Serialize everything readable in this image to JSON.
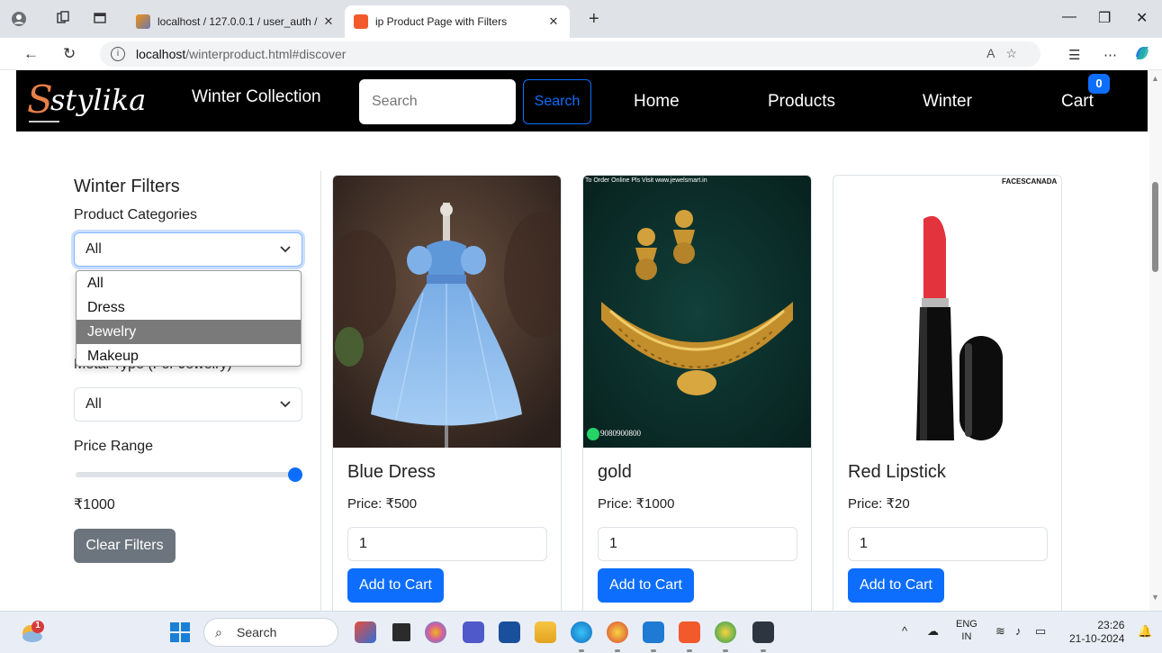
{
  "browser": {
    "tabs": [
      {
        "title": "localhost / 127.0.0.1 / user_auth /",
        "active": false
      },
      {
        "title": "ip Product Page with Filters",
        "active": true
      }
    ],
    "url_host": "localhost",
    "url_path": "/winterproduct.html#discover"
  },
  "navbar": {
    "logo_text": "stylika",
    "brand": "Winter Collection",
    "search_placeholder": "Search",
    "search_button": "Search",
    "links": [
      "Home",
      "Products",
      "Winter",
      "Cart"
    ],
    "cart_count": "0"
  },
  "filters": {
    "title": "Winter Filters",
    "category_label": "Product Categories",
    "category_selected": "All",
    "category_options": [
      "All",
      "Dress",
      "Jewelry",
      "Makeup"
    ],
    "category_highlighted": "Jewelry",
    "metal_label": "Metal Type (For Jewelry)",
    "metal_selected": "All",
    "price_label": "Price Range",
    "price_value": "₹1000",
    "price_slider_fraction": 1.0,
    "clear_button": "Clear Filters"
  },
  "products": [
    {
      "name": "Blue Dress",
      "price": "Price: ₹500",
      "qty": "1",
      "button": "Add to Cart"
    },
    {
      "name": "gold",
      "price": "Price: ₹1000",
      "qty": "1",
      "button": "Add to Cart",
      "image_text": "To Order Online Pls Visit www.jewelsmart.in",
      "phone": "9080900800"
    },
    {
      "name": "Red Lipstick",
      "price": "Price: ₹20",
      "qty": "1",
      "button": "Add to Cart",
      "image_text": "FACESCANADA"
    }
  ],
  "taskbar": {
    "search": "Search",
    "lang": "ENG",
    "region": "IN",
    "time": "23:26",
    "date": "21-10-2024",
    "notification_count": "1"
  },
  "colors": {
    "primary": "#0d6efd",
    "navbar_bg": "#000000",
    "secondary": "#6c757d"
  }
}
